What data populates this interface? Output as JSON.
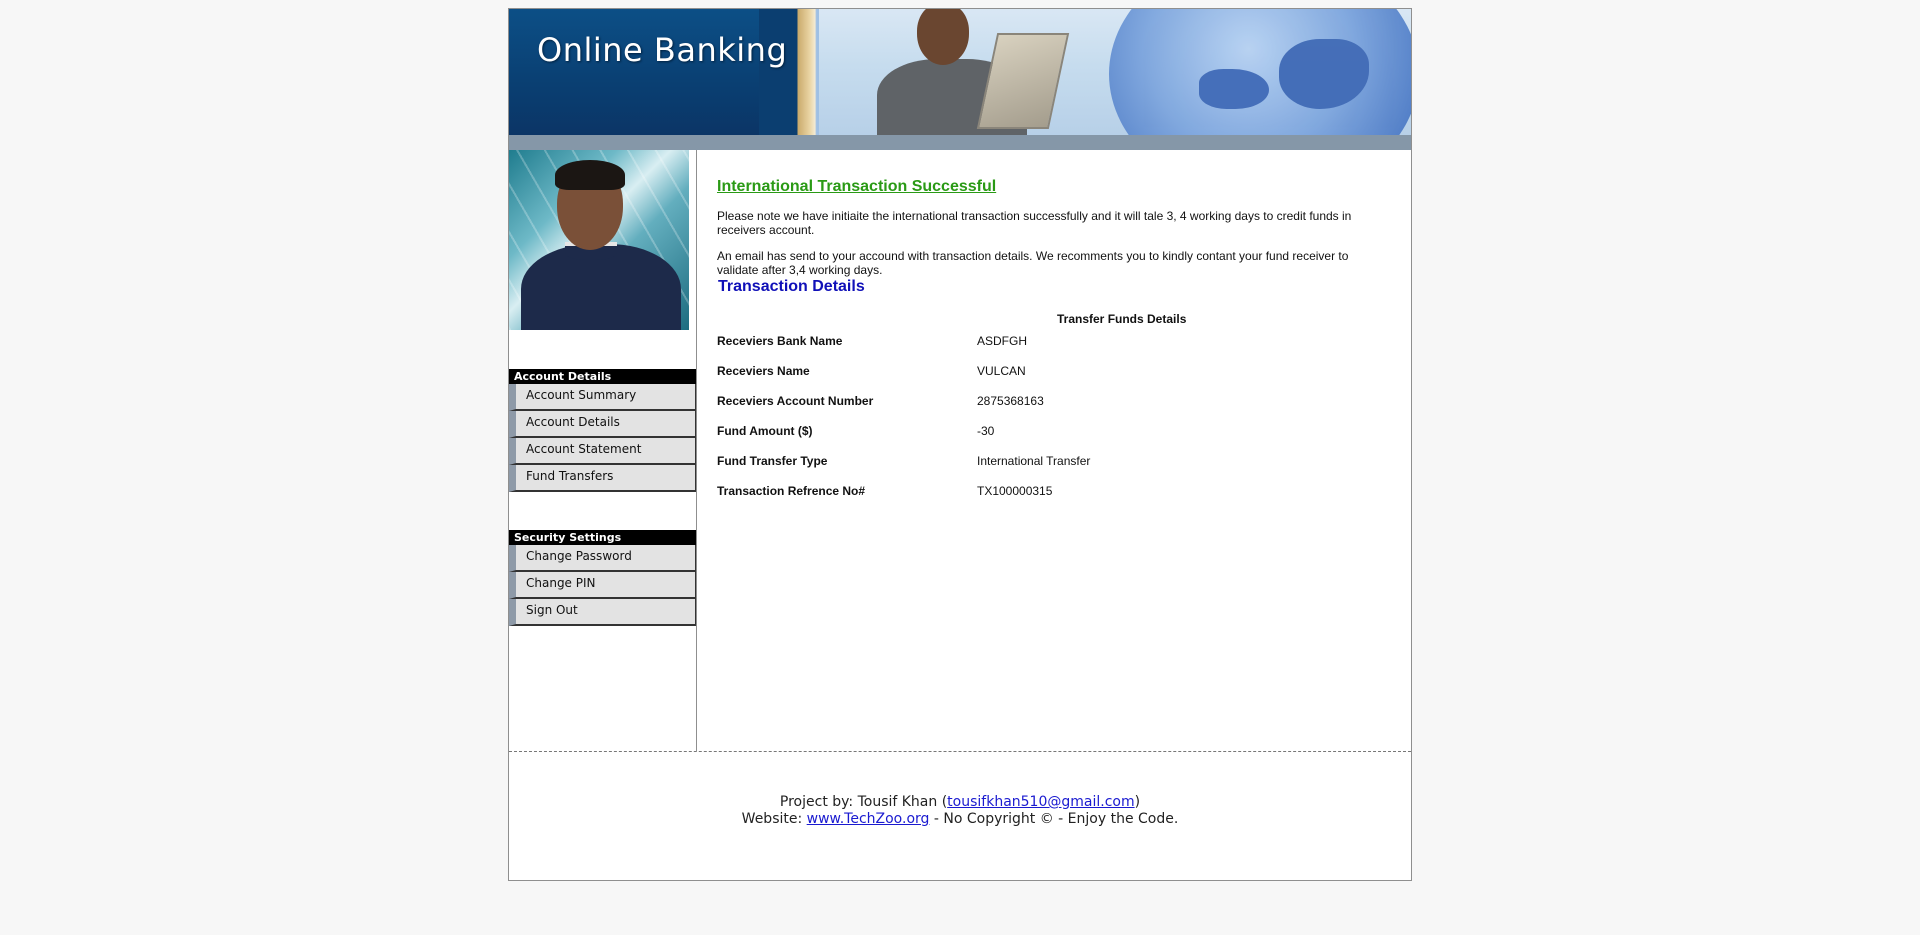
{
  "banner": {
    "title": "Online Banking"
  },
  "sidebar": {
    "account_header": "Account Details",
    "account_items": [
      {
        "label": "Account Summary"
      },
      {
        "label": "Account Details"
      },
      {
        "label": "Account Statement"
      },
      {
        "label": "Fund Transfers"
      }
    ],
    "security_header": "Security Settings",
    "security_items": [
      {
        "label": "Change Password"
      },
      {
        "label": "Change PIN"
      },
      {
        "label": "Sign Out"
      }
    ]
  },
  "main": {
    "success_title": "International Transaction Successful",
    "paragraph1": "Please note we have initiaite the international transaction successfully and it will tale 3, 4 working days to credit funds in receivers account.",
    "paragraph2": "An email has send to your accound with transaction details. We recomments you to kindly contant your fund receiver to validate after 3,4 working days.",
    "details_title": "Transaction Details",
    "table_caption": "Transfer Funds Details",
    "rows": [
      {
        "label": "Receviers Bank Name",
        "value": "ASDFGH"
      },
      {
        "label": "Receviers Name",
        "value": "VULCAN"
      },
      {
        "label": "Receviers Account Number",
        "value": "2875368163"
      },
      {
        "label": "Fund Amount ($)",
        "value": "-30"
      },
      {
        "label": "Fund Transfer Type",
        "value": "International Transfer"
      },
      {
        "label": "Transaction Refrence No#",
        "value": "TX100000315"
      }
    ]
  },
  "footer": {
    "project_prefix": "Project by: Tousif Khan (",
    "email": "tousifkhan510@gmail.com",
    "project_suffix": ")",
    "website_prefix": "Website: ",
    "website": "www.TechZoo.org",
    "website_suffix": " - No Copyright © - Enjoy the Code."
  }
}
